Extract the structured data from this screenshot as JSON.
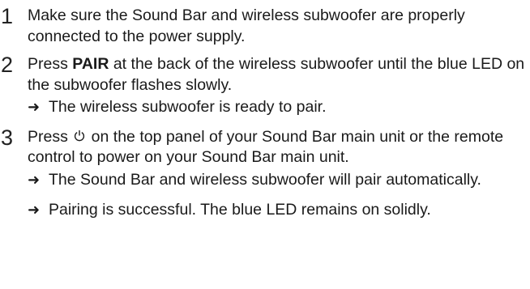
{
  "steps": [
    {
      "number": "1",
      "text": "Make sure the Sound Bar and wireless subwoofer are properly connected to the power supply."
    },
    {
      "number": "2",
      "text_before": "Press ",
      "bold": "PAIR",
      "text_after": " at the back of the wireless subwoofer until the blue LED on the subwoofer flashes slowly.",
      "results": [
        "The wireless subwoofer is ready to pair."
      ]
    },
    {
      "number": "3",
      "text_before": "Press ",
      "icon": "power-icon",
      "text_after": " on the top panel of your Sound Bar main unit or the remote control to power on your Sound Bar main unit.",
      "results": [
        "The Sound Bar and wireless subwoofer will pair automatically.",
        "Pairing is successful. The blue LED remains on solidly."
      ]
    }
  ],
  "arrow_glyph": "➜"
}
